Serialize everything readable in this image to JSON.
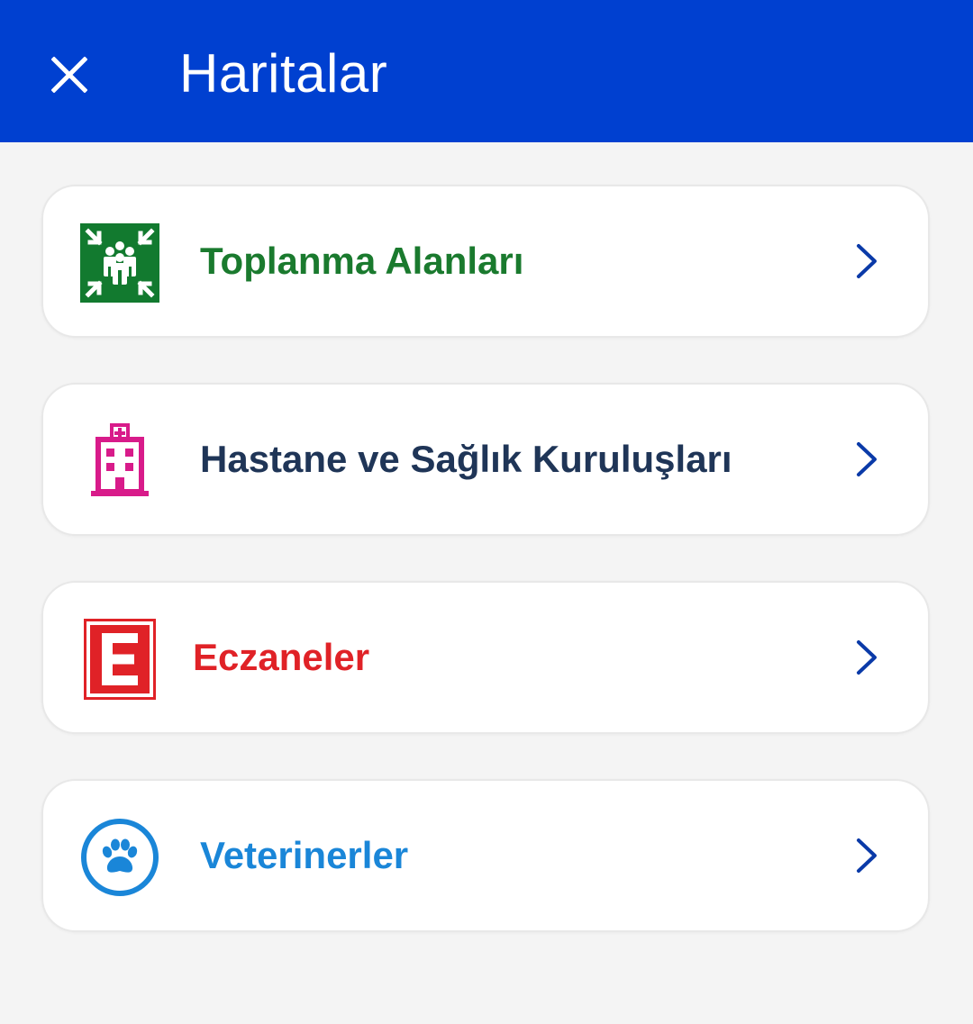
{
  "header": {
    "title": "Haritalar",
    "close_icon": "close-icon",
    "background_color": "#0040d0"
  },
  "menu": {
    "items": [
      {
        "label": "Toplanma Alanları",
        "icon": "assembly-area-icon",
        "color": "#1a7a2e"
      },
      {
        "label": "Hastane ve Sağlık Kuruluşları",
        "icon": "hospital-icon",
        "color": "#1f3557"
      },
      {
        "label": "Eczaneler",
        "icon": "pharmacy-icon",
        "color": "#e02227"
      },
      {
        "label": "Veterinerler",
        "icon": "paw-icon",
        "color": "#1a86d8"
      }
    ],
    "chevron_icon": "chevron-right-icon",
    "chevron_color": "#0a3aa8"
  }
}
